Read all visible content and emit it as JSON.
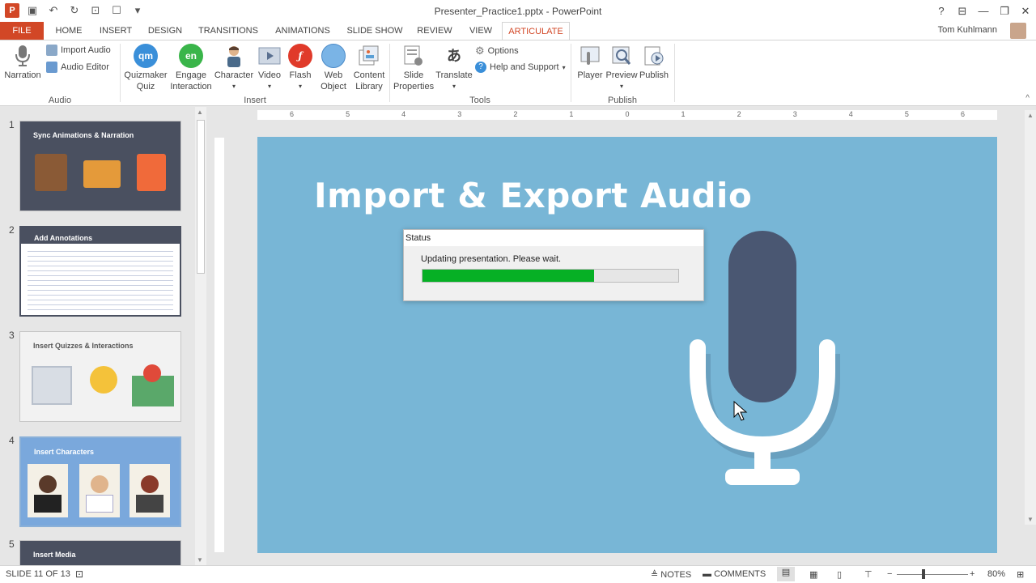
{
  "window": {
    "title": "Presenter_Practice1.pptx - PowerPoint"
  },
  "quick_access": {
    "app_logo": "P"
  },
  "tabs": [
    {
      "label": "FILE"
    },
    {
      "label": "HOME"
    },
    {
      "label": "INSERT"
    },
    {
      "label": "DESIGN"
    },
    {
      "label": "TRANSITIONS"
    },
    {
      "label": "ANIMATIONS"
    },
    {
      "label": "SLIDE SHOW"
    },
    {
      "label": "REVIEW"
    },
    {
      "label": "VIEW"
    },
    {
      "label": "ARTICULATE"
    }
  ],
  "user": {
    "name": "Tom Kuhlmann"
  },
  "ribbon": {
    "audio": {
      "label": "Audio",
      "narration": "Narration",
      "import_audio": "Import Audio",
      "audio_editor": "Audio Editor"
    },
    "insert": {
      "label": "Insert",
      "quizmaker": {
        "line1": "Quizmaker",
        "line2": "Quiz",
        "badge": "qm"
      },
      "engage": {
        "line1": "Engage",
        "line2": "Interaction",
        "badge": "en"
      },
      "character": "Character",
      "video": "Video",
      "flash": "Flash",
      "web_object": {
        "line1": "Web",
        "line2": "Object"
      },
      "content_library": {
        "line1": "Content",
        "line2": "Library"
      }
    },
    "tools": {
      "label": "Tools",
      "slide_properties": {
        "line1": "Slide",
        "line2": "Properties"
      },
      "translate": "Translate",
      "options": "Options",
      "help": "Help and Support"
    },
    "publish": {
      "label": "Publish",
      "player": "Player",
      "preview": "Preview",
      "publish": "Publish"
    }
  },
  "thumbnails": [
    {
      "num": "1",
      "title": "Sync Animations & Narration"
    },
    {
      "num": "2",
      "title": "Add Annotations"
    },
    {
      "num": "3",
      "title": "Insert Quizzes & Interactions"
    },
    {
      "num": "4",
      "title": "Insert Characters"
    },
    {
      "num": "5",
      "title": "Insert Media"
    }
  ],
  "ruler": {
    "h_ticks": [
      "6",
      "5",
      "4",
      "3",
      "2",
      "1",
      "0",
      "1",
      "2",
      "3",
      "4",
      "5",
      "6"
    ]
  },
  "slide": {
    "title": "Import & Export Audio"
  },
  "dialog": {
    "title": "Status",
    "message": "Updating presentation. Please wait.",
    "progress": 0.67
  },
  "status": {
    "slide_info": "SLIDE 11 OF 13",
    "notes": "NOTES",
    "comments": "COMMENTS",
    "zoom": "80%"
  },
  "colors": {
    "accent": "#d24726",
    "slide_bg": "#78b6d6",
    "progress": "#06b025"
  }
}
